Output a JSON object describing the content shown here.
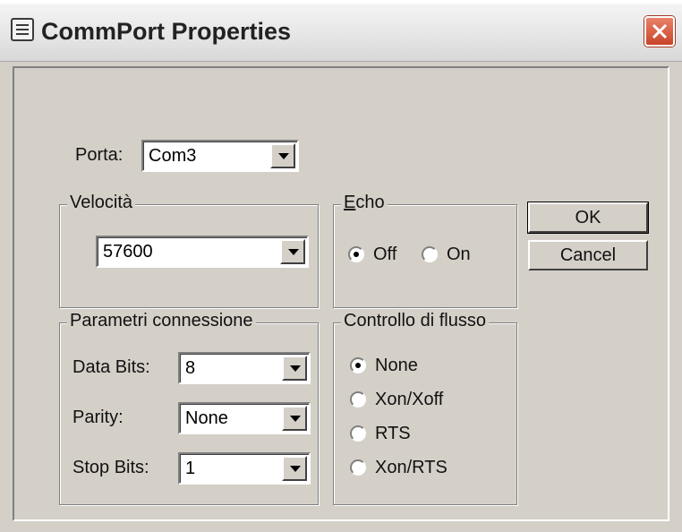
{
  "window": {
    "title": "CommPort Properties"
  },
  "porta": {
    "label": "Porta:",
    "value": "Com3"
  },
  "velocita": {
    "group_label": "Velocità",
    "value": "57600"
  },
  "echo": {
    "group_label_first": "E",
    "group_label_rest": "cho",
    "options": [
      {
        "label": "Off",
        "selected": true
      },
      {
        "label": "On",
        "selected": false
      }
    ]
  },
  "buttons": {
    "ok": "OK",
    "cancel": "Cancel"
  },
  "parametri": {
    "group_label": "Parametri connessione",
    "data_bits": {
      "label": "Data Bits:",
      "value": "8"
    },
    "parity": {
      "label": "Parity:",
      "value": "None"
    },
    "stop_bits": {
      "label": "Stop Bits:",
      "value": "1"
    }
  },
  "flusso": {
    "group_label": "Controllo di flusso",
    "options": [
      {
        "label": "None",
        "selected": true
      },
      {
        "label": "Xon/Xoff",
        "selected": false
      },
      {
        "label": "RTS",
        "selected": false
      },
      {
        "label": "Xon/RTS",
        "selected": false
      }
    ]
  },
  "icons": {
    "app": "serial-port-icon",
    "close": "close-icon",
    "dropdown": "chevron-down-icon"
  },
  "colors": {
    "face": "#d4d0c8",
    "close": "#c8442a"
  }
}
